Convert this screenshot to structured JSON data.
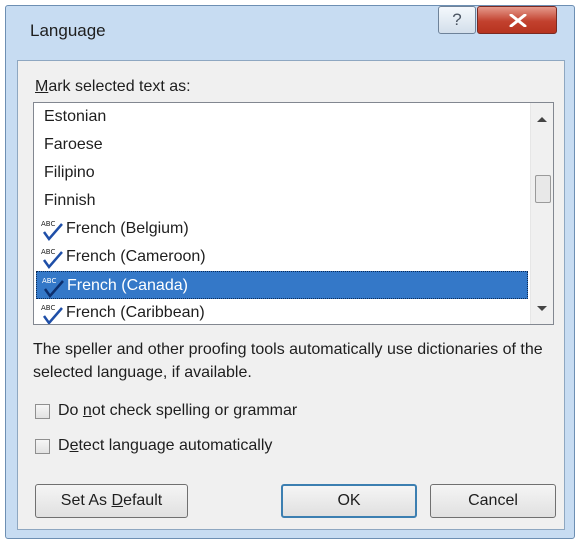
{
  "window": {
    "title": "Language",
    "help_label": "?",
    "close_label": "X"
  },
  "list": {
    "label_prefix": "",
    "label_mnemonic": "M",
    "label_suffix": "ark selected text as:",
    "items": [
      {
        "label": "Estonian",
        "icon": "",
        "selected": false
      },
      {
        "label": "Faroese",
        "icon": "",
        "selected": false
      },
      {
        "label": "Filipino",
        "icon": "",
        "selected": false
      },
      {
        "label": "Finnish",
        "icon": "",
        "selected": false
      },
      {
        "label": "French (Belgium)",
        "icon": "abc-spellcheck-icon",
        "selected": false
      },
      {
        "label": "French (Cameroon)",
        "icon": "abc-spellcheck-icon",
        "selected": false
      },
      {
        "label": "French (Canada)",
        "icon": "abc-spellcheck-icon",
        "selected": true
      },
      {
        "label": "French (Caribbean)",
        "icon": "abc-spellcheck-icon",
        "selected": false
      }
    ],
    "selection_color": "#3478c8"
  },
  "info_text": "The speller and other proofing tools automatically use dictionaries of the selected language, if available.",
  "options": {
    "no_check": {
      "pre": "Do ",
      "mnemonic": "n",
      "post": "ot check spelling or grammar",
      "checked": false
    },
    "detect": {
      "pre": "D",
      "mnemonic": "e",
      "post": "tect language automatically",
      "checked": false
    }
  },
  "buttons": {
    "set_default": {
      "pre": "Set As ",
      "mnemonic": "D",
      "post": "efault"
    },
    "ok": "OK",
    "cancel": "Cancel"
  }
}
